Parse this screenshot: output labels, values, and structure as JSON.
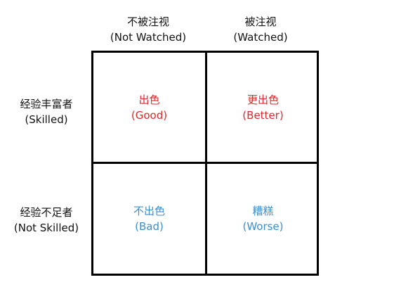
{
  "columns": [
    {
      "zh": "不被注视",
      "en": "(Not Watched)"
    },
    {
      "zh": "被注视",
      "en": "(Watched)"
    }
  ],
  "rows": [
    {
      "zh": "经验丰富者",
      "en": "(Skilled)"
    },
    {
      "zh": "经验不足者",
      "en": "(Not Skilled)"
    }
  ],
  "cells": [
    {
      "zh": "出色",
      "en": "(Good)"
    },
    {
      "zh": "更出色",
      "en": "(Better)"
    },
    {
      "zh": "不出色",
      "en": "(Bad)"
    },
    {
      "zh": "糟糕",
      "en": "(Worse)"
    }
  ],
  "colors": {
    "positive": "#e5262b",
    "negative": "#3a8fd0"
  }
}
